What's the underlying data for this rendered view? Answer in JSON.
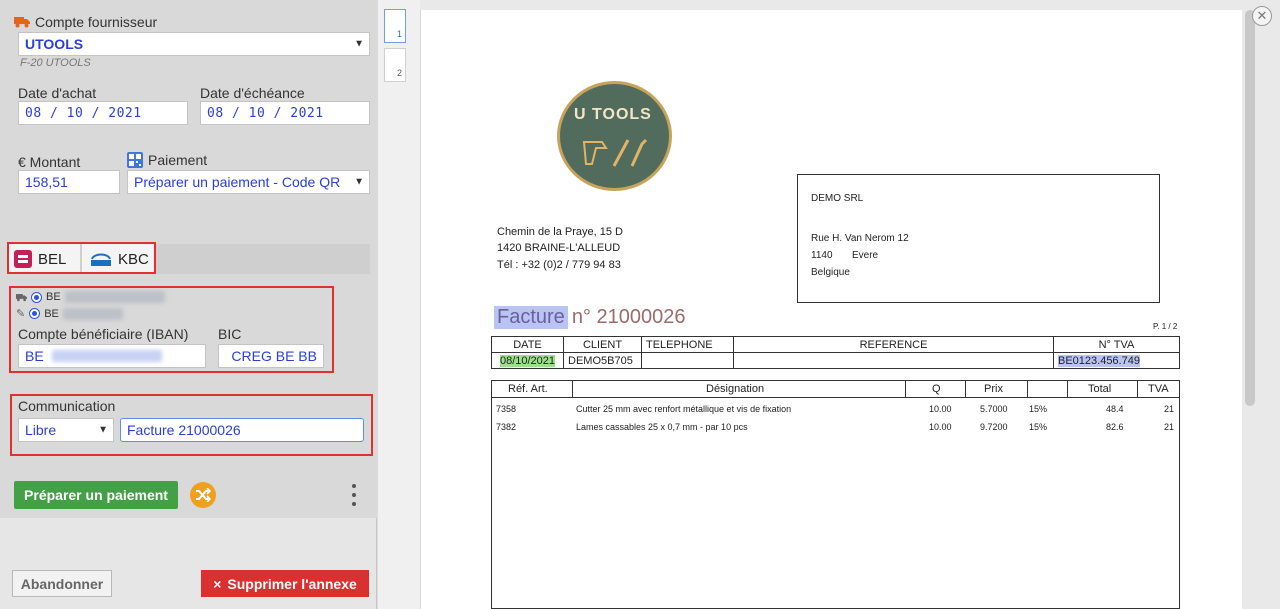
{
  "supplier": {
    "label": "Compte fournisseur",
    "value": "UTOOLS",
    "code": "F-20 UTOOLS"
  },
  "dates": {
    "purchase_label": "Date d'achat",
    "purchase_value": "08 / 10 / 2021",
    "due_label": "Date d'échéance",
    "due_value": "08 / 10 / 2021"
  },
  "amount": {
    "label": "€ Montant",
    "value": "158,51"
  },
  "payment": {
    "label": "Paiement",
    "value": "Préparer un paiement - Code QR"
  },
  "bank_tabs": [
    {
      "label": "BEL"
    },
    {
      "label": "KBC"
    }
  ],
  "accounts": {
    "option1": "BE",
    "option2": "BE",
    "iban_label": "Compte bénéficiaire (IBAN)",
    "iban_value": "BE",
    "bic_label": "BIC",
    "bic_value": "CREG BE BB"
  },
  "communication": {
    "label": "Communication",
    "type_value": "Libre",
    "text_value": "Facture 21000026"
  },
  "actions": {
    "prepare_label": "Préparer un paiement",
    "abandon_label": "Abandonner",
    "delete_label": "Supprimer l'annexe",
    "delete_icon": "×"
  },
  "pages": [
    "1",
    "2"
  ],
  "invoice": {
    "logo_text": "TOOLS",
    "logo_letter": "U",
    "sender_address": [
      "Chemin de la Praye, 15 D",
      "1420 BRAINE-L'ALLEUD",
      "Tél : +32 (0)2 / 779 94 83"
    ],
    "client_name": "DEMO SRL",
    "client_street": "Rue H. Van Nerom 12",
    "client_zip": "1140",
    "client_city": "Evere",
    "client_country": "Belgique",
    "title_word": "Facture",
    "title_number": "n° 21000026",
    "page_ref": "P. 1 / 2",
    "header_cols": [
      "DATE",
      "CLIENT",
      "TELEPHONE",
      "REFERENCE",
      "N° TVA"
    ],
    "header_vals": [
      "08/10/2021",
      "DEMO5B705",
      "",
      "",
      "BE0123.456.749"
    ],
    "line_cols": [
      "Réf. Art.",
      "Désignation",
      "Q",
      "Prix",
      "",
      "Total",
      "TVA"
    ],
    "lines": [
      {
        "ref": "7358",
        "desc": "Cutter 25 mm avec renfort métallique et vis de fixation",
        "q": "10.00",
        "price": "5.7000",
        "disc": "15%",
        "total": "48.4",
        "vat": "21"
      },
      {
        "ref": "7382",
        "desc": "Lames cassables 25 x 0,7 mm - par 10 pcs",
        "q": "10.00",
        "price": "9.7200",
        "disc": "15%",
        "total": "82.6",
        "vat": "21"
      }
    ]
  }
}
